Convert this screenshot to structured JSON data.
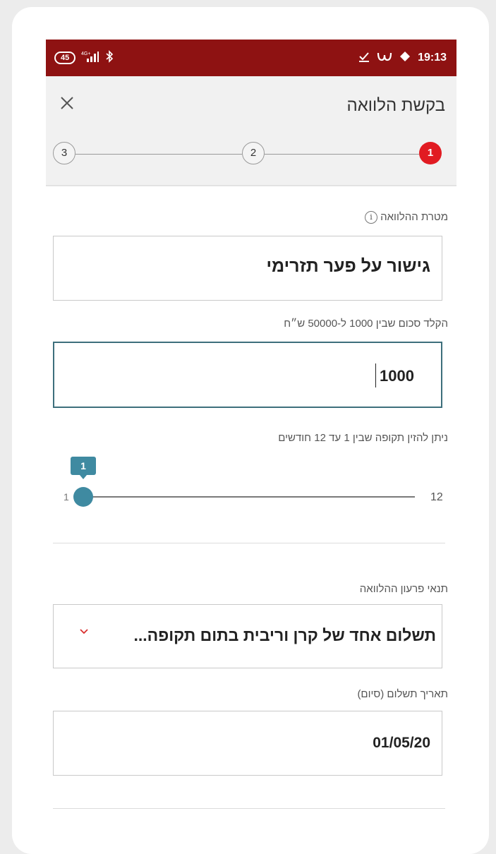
{
  "status_bar": {
    "battery": "45",
    "network": "4G+",
    "time": "19:13"
  },
  "header": {
    "title": "בקשת הלוואה",
    "close_icon": "close-icon"
  },
  "stepper": {
    "steps": [
      "1",
      "2",
      "3"
    ],
    "active_step": "1"
  },
  "form": {
    "purpose": {
      "label": "מטרת ההלוואה",
      "info_icon_glyph": "i",
      "value": "גישור על פער תזרימי"
    },
    "amount": {
      "label": "הקלד סכום שבין 1000 ל-50000 ש״ח",
      "value": "1000"
    },
    "period": {
      "label": "ניתן להזין תקופה שבין 1 עד 12 חודשים",
      "value": "1",
      "min": "1",
      "max": "12"
    },
    "repayment_terms": {
      "label": "תנאי פרעון ההלוואה",
      "value": "תשלום אחד של קרן וריבית בתום תקופה..."
    },
    "payment_date": {
      "label": "תאריך תשלום (סיום)",
      "value": "01/05/20"
    }
  },
  "colors": {
    "status_bar": "#8e1212",
    "active_step": "#e11b22",
    "slider": "#3f8aa1",
    "focus_border": "#3d6f7c",
    "dropdown_chevron": "#d9302f"
  }
}
